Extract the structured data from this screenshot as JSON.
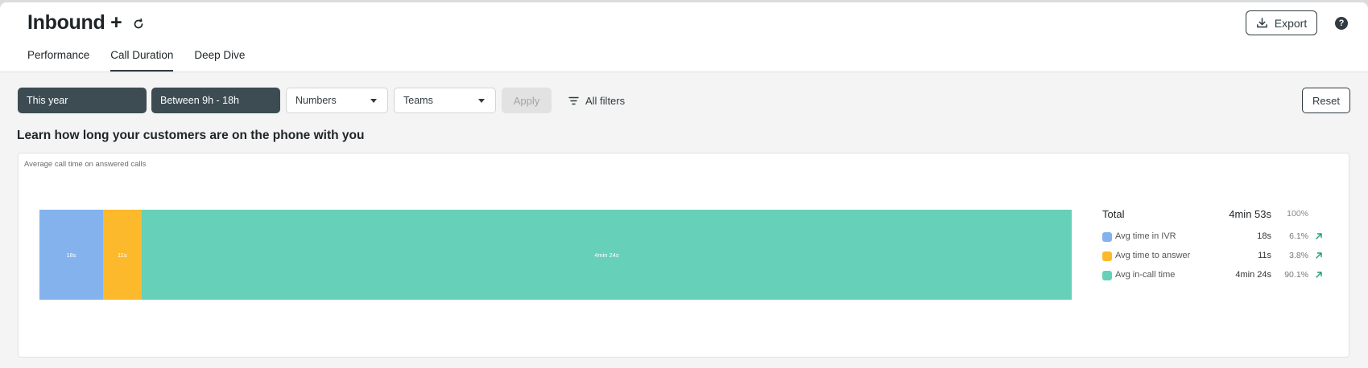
{
  "header": {
    "title": "Inbound +",
    "tabs": [
      {
        "label": "Performance",
        "active": false
      },
      {
        "label": "Call Duration",
        "active": true
      },
      {
        "label": "Deep Dive",
        "active": false
      }
    ],
    "export_label": "Export",
    "help_label": "?"
  },
  "filters": {
    "period": "This year",
    "hours": "Between 9h - 18h",
    "numbers": "Numbers",
    "teams": "Teams",
    "apply_label": "Apply",
    "all_filters_label": "All filters",
    "reset_label": "Reset"
  },
  "main": {
    "section_title": "Learn how long your customers are on the phone with you",
    "card_label": "Average call time on answered calls"
  },
  "colors": {
    "ivr": "#84b2ec",
    "answer": "#fcb92c",
    "incall": "#66d0b8",
    "dark": "#3c4c52",
    "trend": "#1e9a7a"
  },
  "chart_data": {
    "type": "bar",
    "orientation": "horizontal-stacked",
    "segments": [
      {
        "name": "Avg time in IVR",
        "label": "18s",
        "seconds": 18,
        "percent": "6.1%"
      },
      {
        "name": "Avg time to answer",
        "label": "11s",
        "seconds": 11,
        "percent": "3.8%"
      },
      {
        "name": "Avg in-call time",
        "label": "4min 24s",
        "seconds": 264,
        "percent": "90.1%"
      }
    ],
    "total": {
      "label": "Total",
      "value": "4min 53s",
      "percent": "100%"
    }
  }
}
